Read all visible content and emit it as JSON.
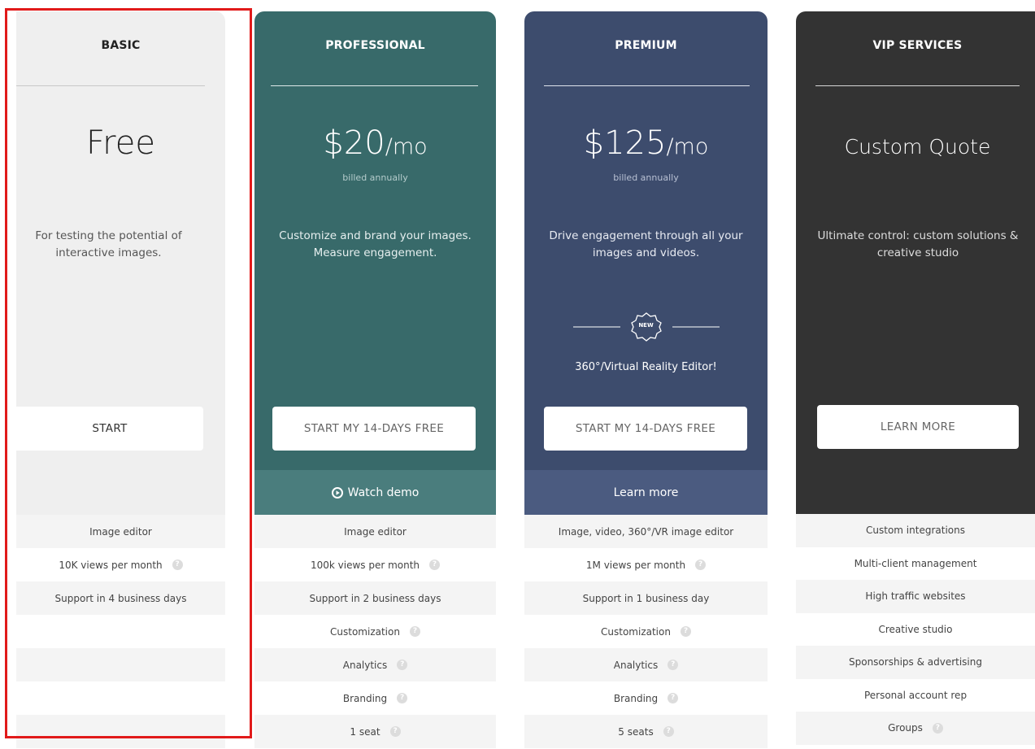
{
  "plans": [
    {
      "name": "BASIC",
      "price_main": "Free",
      "price_unit": "",
      "billing": "",
      "description": "For testing the potential of interactive images.",
      "cta_label": "START",
      "sub_cta_label": "",
      "features": [
        {
          "text": "Image editor",
          "help": false
        },
        {
          "text": "10K views per month",
          "help": true
        },
        {
          "text": "Support in 4 business days",
          "help": false
        },
        {
          "text": "",
          "help": false
        },
        {
          "text": "",
          "help": false
        },
        {
          "text": "",
          "help": false
        },
        {
          "text": "",
          "help": false
        }
      ]
    },
    {
      "name": "PROFESSIONAL",
      "price_main": "$20",
      "price_unit": "/mo",
      "billing": "billed annually",
      "description": "Customize and brand your images. Measure engagement.",
      "cta_label": "START MY 14-DAYS FREE",
      "sub_cta_label": "Watch demo",
      "features": [
        {
          "text": "Image editor",
          "help": false
        },
        {
          "text": "100k views per month",
          "help": true
        },
        {
          "text": "Support in 2 business days",
          "help": false
        },
        {
          "text": "Customization",
          "help": true
        },
        {
          "text": "Analytics",
          "help": true
        },
        {
          "text": "Branding",
          "help": true
        },
        {
          "text": "1 seat",
          "help": true
        }
      ]
    },
    {
      "name": "PREMIUM",
      "price_main": "$125",
      "price_unit": "/mo",
      "billing": "billed annually",
      "description": "Drive engagement through all your images and videos.",
      "badge_text": "NEW",
      "new_feature": "360°/Virtual Reality Editor!",
      "cta_label": "START MY 14-DAYS FREE",
      "sub_cta_label": "Learn more",
      "features": [
        {
          "text": "Image, video, 360°/VR image editor",
          "help": false
        },
        {
          "text": "1M views per month",
          "help": true
        },
        {
          "text": "Support in 1 business day",
          "help": false
        },
        {
          "text": "Customization",
          "help": true
        },
        {
          "text": "Analytics",
          "help": true
        },
        {
          "text": "Branding",
          "help": true
        },
        {
          "text": "5 seats",
          "help": true
        }
      ]
    },
    {
      "name": "VIP SERVICES",
      "price_main": "Custom Quote",
      "price_unit": "",
      "billing": "",
      "description": "Ultimate control: custom solutions & creative studio",
      "cta_label": "LEARN MORE",
      "sub_cta_label": "",
      "features": [
        {
          "text": "Custom integrations",
          "help": false
        },
        {
          "text": "Multi-client management",
          "help": false
        },
        {
          "text": "High traffic websites",
          "help": false
        },
        {
          "text": "Creative studio",
          "help": false
        },
        {
          "text": "Sponsorships & advertising",
          "help": false
        },
        {
          "text": "Personal account rep",
          "help": false
        },
        {
          "text": "Groups",
          "help": true
        }
      ]
    }
  ],
  "colors": {
    "basic_bg": "#efefef",
    "professional_bg": "#386a6a",
    "professional_sub": "#4a7d7d",
    "premium_bg": "#3d4c6d",
    "premium_sub": "#4b5b80",
    "vip_bg": "#333333",
    "highlight": "#e11a1a"
  }
}
